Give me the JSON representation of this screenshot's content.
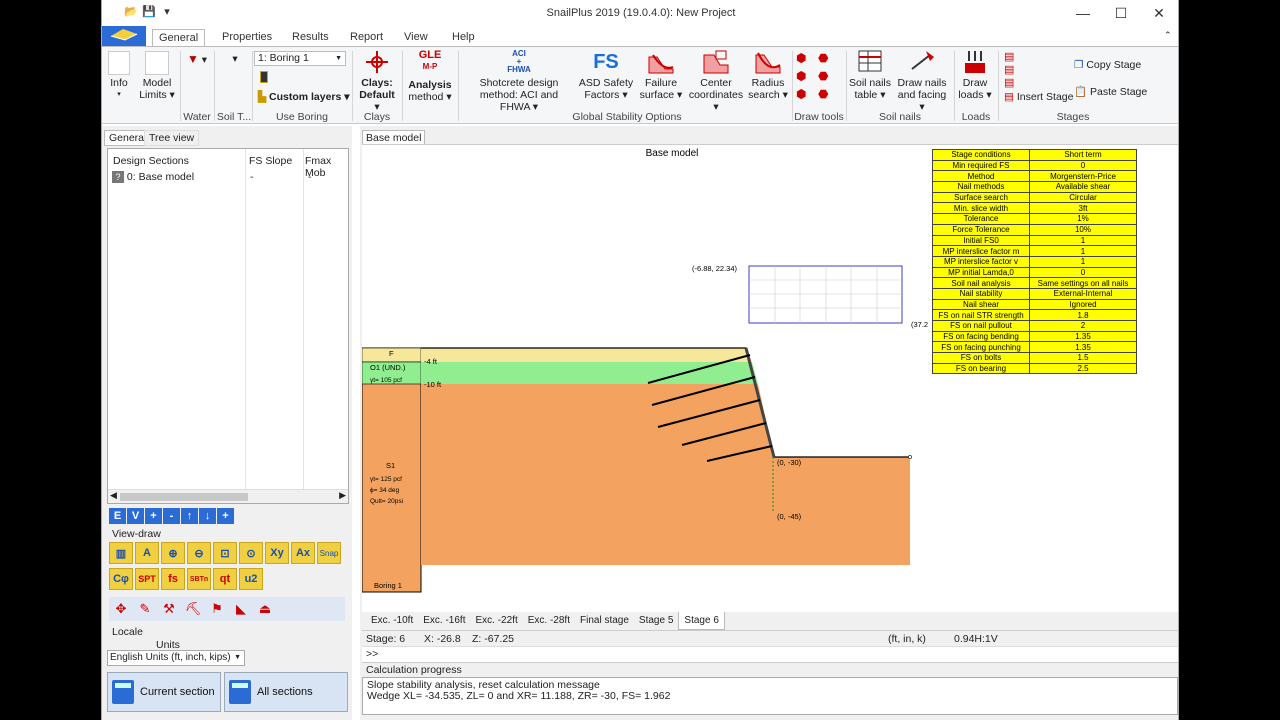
{
  "window": {
    "title": "SnailPlus 2019 (19.0.4.0): New Project"
  },
  "ribbon_tabs": [
    "General",
    "Properties",
    "Results",
    "Report",
    "View",
    "Help"
  ],
  "ribbon": {
    "info": "Info",
    "model_limits": [
      "Model",
      "Limits"
    ],
    "water": "Water",
    "soil": "Soil T...",
    "boring_select": "1: Boring 1",
    "custom_layers": "Custom layers",
    "use_boring": "Use Boring",
    "clays_default": [
      "Clays:",
      "Default"
    ],
    "clays": "Clays",
    "analysis_method": [
      "Analysis",
      "method"
    ],
    "gle_label": "GLE",
    "mp_label": "M-P",
    "aci_label": "ACI",
    "plus_label": "+",
    "fhwa_label": "FHWA",
    "shotcrete": [
      "Shotcrete design",
      "method: ACI and FHWA"
    ],
    "fs_label": "FS",
    "asd_safety": [
      "ASD Safety",
      "Factors"
    ],
    "failure_surface": [
      "Failure",
      "surface"
    ],
    "center_coords": [
      "Center",
      "coordinates"
    ],
    "radius_search": [
      "Radius",
      "search"
    ],
    "global_stability": "Global Stability Options",
    "draw_tools": "Draw tools",
    "soil_nails_table": [
      "Soil nails",
      "table"
    ],
    "draw_nails": [
      "Draw nails",
      "and facing"
    ],
    "soil_nails": "Soil nails",
    "draw_loads": [
      "Draw",
      "loads"
    ],
    "loads": "Loads",
    "insert_stage": "Insert Stage",
    "copy_stage": "Copy Stage",
    "paste_stage": "Paste Stage",
    "stages": "Stages"
  },
  "left": {
    "tabs": [
      "General",
      "Tree view"
    ],
    "columns": [
      "Design Sections",
      "FS Slope",
      "Fmax Mob"
    ],
    "rows": [
      {
        "name": "0: Base model",
        "fs": "-",
        "fmax": "-"
      }
    ],
    "toolbuttons": [
      "E",
      "V",
      "+",
      "-",
      "↑",
      "↓",
      "+"
    ],
    "view_draw": "View-draw",
    "icons_row1": [
      "A",
      "Xy",
      "Ax",
      "Snap"
    ],
    "icons_row2": [
      "Cφ",
      "SPT",
      "fs",
      "SBTn",
      "qt",
      "u2"
    ],
    "locale": "Locale",
    "units_label": "Units",
    "units_value": "English Units (ft, inch, kips)",
    "current_section": "Current section",
    "all_sections": "All sections"
  },
  "doc": {
    "tab": "Base model",
    "canvas_title": "Base model",
    "coord_topleft": "(-6.88, 22.34)",
    "coord_right": "(37.2",
    "coord_toe": "(0, -30)",
    "coord_bottom": "(0, -45)",
    "layer_f": "F",
    "depth_4": "-4 ft",
    "layer_o1": "O1 (UND.)",
    "layer_o1_gamma": "γt= 105 pcf",
    "depth_10": "-10 ft",
    "layer_s1": "S1",
    "layer_s1_gamma": "γt= 125 pcf",
    "layer_s1_phi": "ϕ= 34 deg",
    "layer_s1_qult": "Qult= 20psi",
    "boring_label": "Boring 1"
  },
  "params": [
    [
      "Stage conditions",
      "Short term"
    ],
    [
      "Min required FS",
      "0"
    ],
    [
      "Method",
      "Morgenstern-Price"
    ],
    [
      "Nail methods",
      "Available shear"
    ],
    [
      "Surface search",
      "Circular"
    ],
    [
      "Min. slice width",
      "3ft"
    ],
    [
      "Tolerance",
      "1%"
    ],
    [
      "Force Tolerance",
      "10%"
    ],
    [
      "Initial FS0",
      "1"
    ],
    [
      "MP interslice factor m",
      "1"
    ],
    [
      "MP interslice factor v",
      "1"
    ],
    [
      "MP initial Lamda,0",
      "0"
    ],
    [
      "Soil nail analysis",
      "Same settings on all nails"
    ],
    [
      "Nail stability",
      "External-Internal"
    ],
    [
      "Nail shear",
      "Ignored"
    ],
    [
      "FS on nail STR strength",
      "1.8"
    ],
    [
      "FS on nail pullout",
      "2"
    ],
    [
      "FS on facing bending",
      "1.35"
    ],
    [
      "FS on facing punching",
      "1.35"
    ],
    [
      "FS on bolts",
      "1.5"
    ],
    [
      "FS on bearing",
      "2.5"
    ]
  ],
  "stage_tabs": [
    "Exc. -10ft",
    "Exc. -16ft",
    "Exc. -22ft",
    "Exc. -28ft",
    "Final stage",
    "Stage 5",
    "Stage 6"
  ],
  "active_stage": "Stage 6",
  "status": {
    "stage": "Stage: 6",
    "x": "X: -26.8",
    "z": "Z: -67.25",
    "units": "(ft, in, k)",
    "scale": "0.94H:1V"
  },
  "cmd_prompt": ">>",
  "calc_progress": "Calculation progress",
  "messages": [
    "Slope stability analysis, reset calculation message",
    "Wedge XL= -34.535, ZL= 0 and XR= 11.188, ZR= -30, FS= 1.962"
  ]
}
